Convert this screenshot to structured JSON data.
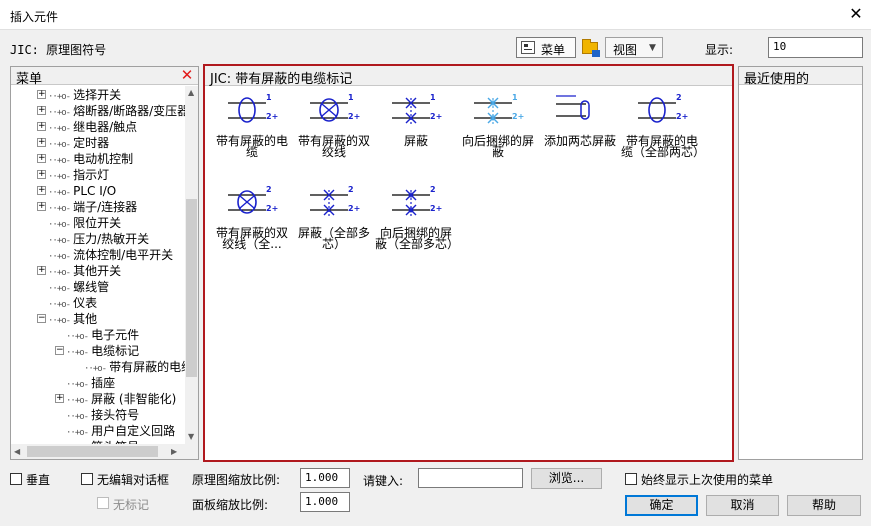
{
  "window": {
    "title": "插入元件",
    "close_glyph": "✕"
  },
  "header": {
    "standard_label": "JIC: 原理图符号",
    "menu_button_label": "菜单",
    "view_button_label": "视图",
    "display_label": "显示:",
    "display_value": "10"
  },
  "tree": {
    "title": "菜单",
    "items": [
      {
        "label": "选择开关",
        "expander": "+"
      },
      {
        "label": "熔断器/断路器/变压器",
        "expander": "+"
      },
      {
        "label": "继电器/触点",
        "expander": "+"
      },
      {
        "label": "定时器",
        "expander": "+"
      },
      {
        "label": "电动机控制",
        "expander": "+"
      },
      {
        "label": "指示灯",
        "expander": "+"
      },
      {
        "label": "PLC I/O",
        "expander": "+"
      },
      {
        "label": "端子/连接器",
        "expander": "+"
      },
      {
        "label": "限位开关",
        "expander": ""
      },
      {
        "label": "压力/热敏开关",
        "expander": ""
      },
      {
        "label": "流体控制/电平开关",
        "expander": ""
      },
      {
        "label": "其他开关",
        "expander": "+"
      },
      {
        "label": "螺线管",
        "expander": ""
      },
      {
        "label": "仪表",
        "expander": ""
      },
      {
        "label": "其他",
        "expander": "−"
      },
      {
        "label": "电子元件",
        "expander": ""
      },
      {
        "label": "电缆标记",
        "expander": "−"
      },
      {
        "label": "带有屏蔽的电缆标记",
        "expander": ""
      },
      {
        "label": "插座",
        "expander": ""
      },
      {
        "label": "屏蔽 (非智能化)",
        "expander": "+"
      },
      {
        "label": "接头符号",
        "expander": ""
      },
      {
        "label": "用户自定义回路",
        "expander": ""
      },
      {
        "label": "箭头符号",
        "expander": ""
      }
    ]
  },
  "symbols": {
    "title": "JIC: 带有屏蔽的电缆标记",
    "items": [
      {
        "caption": "带有屏蔽的电缆",
        "icon": "shielded-cable-icon",
        "n1": "1",
        "n2": "2+"
      },
      {
        "caption": "带有屏蔽的双绞线",
        "icon": "shielded-twisted-pair-icon",
        "n1": "1",
        "n2": "2+"
      },
      {
        "caption": "屏蔽",
        "icon": "shield-icon",
        "n1": "1",
        "n2": "2+"
      },
      {
        "caption": "向后捆绑的屏蔽",
        "icon": "shield-tied-back-icon",
        "n1": "1",
        "n2": "2+"
      },
      {
        "caption": "添加两芯屏蔽",
        "icon": "add-two-conductor-shield-icon",
        "n1": "",
        "n2": ""
      },
      {
        "caption": "带有屏蔽的电缆（全部两芯）",
        "icon": "shielded-cable-all-icon",
        "n1": "2",
        "n2": "2+"
      },
      {
        "caption": "带有屏蔽的双绞线（全...",
        "icon": "shielded-twisted-pair-all-icon",
        "n1": "2",
        "n2": "2+"
      },
      {
        "caption": "屏蔽（全部多芯）",
        "icon": "shield-all-icon",
        "n1": "2",
        "n2": "2+"
      },
      {
        "caption": "向后捆绑的屏蔽（全部多芯）",
        "icon": "shield-tied-back-all-icon",
        "n1": "2",
        "n2": "2+"
      }
    ]
  },
  "recent": {
    "title": "最近使用的"
  },
  "footer": {
    "vertical_label": "垂直",
    "no_edit_dialog_label": "无编辑对话框",
    "no_tag_label": "无标记",
    "schematic_scale_label": "原理图缩放比例:",
    "schematic_scale_value": "1.000",
    "panel_scale_label": "面板缩放比例:",
    "panel_scale_value": "1.000",
    "type_it_label": "请键入:",
    "type_it_value": "",
    "browse_label": "浏览...",
    "always_show_last_menu_label": "始终显示上次使用的菜单",
    "ok_label": "确定",
    "cancel_label": "取消",
    "help_label": "帮助"
  },
  "colors": {
    "symbol_blue": "#1a22cc",
    "symbol_light_blue": "#4aa8e6",
    "panel_border_red": "#b0191e",
    "close_red": "#e21b1b"
  }
}
